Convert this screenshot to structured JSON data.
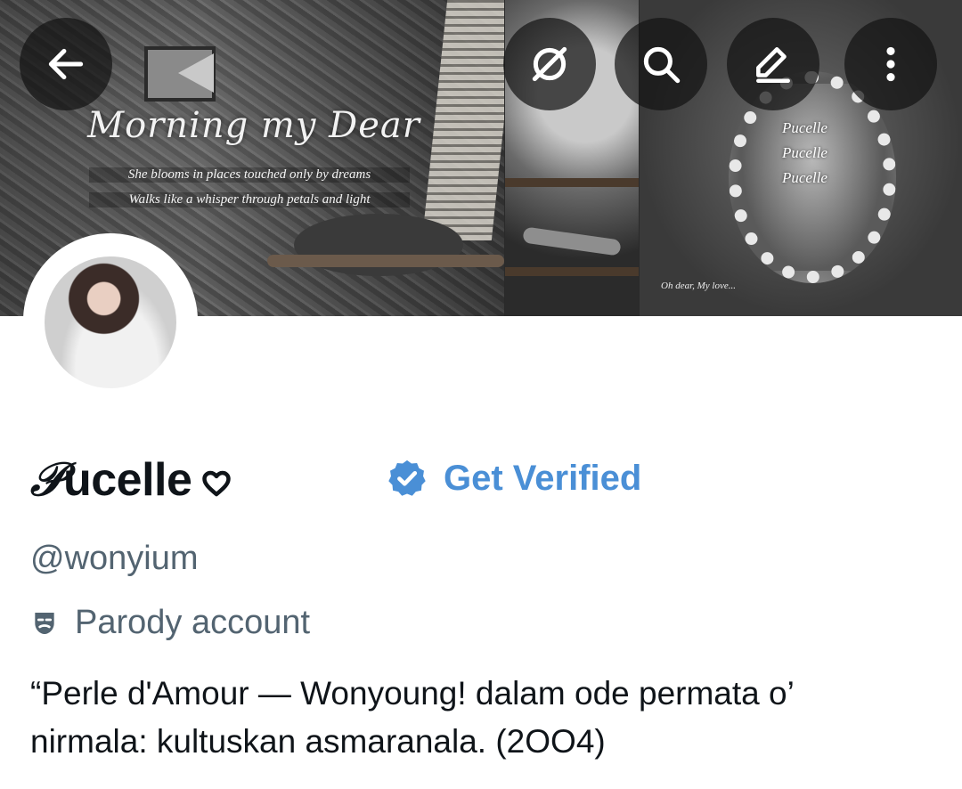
{
  "banner": {
    "title_script": "Morning my Dear",
    "line1": "She blooms in places touched only by dreams",
    "line2": "Walks like a whisper through petals and light",
    "pucelle_words": [
      "Pucelle",
      "Pucelle",
      "Pucelle"
    ],
    "caption": "Oh dear, My love..."
  },
  "toolbar": {
    "back": "back-arrow-icon",
    "grok": "grok-icon",
    "search": "search-icon",
    "edit": "edit-icon",
    "more": "more-vertical-icon"
  },
  "profile": {
    "name_initial": "𝒫",
    "name_rest": "ucelle",
    "heart": "heart-icon",
    "verified_label": "Get Verified",
    "handle": "@wonyium",
    "parody_label": "Parody account",
    "bio_line1": "“Perle d'Amour — Wonyoung! dalam ode permata o’",
    "bio_line2": "nirmala: kultuskan asmaranala.  (2OO4)"
  },
  "colors": {
    "accent": "#4a8fd6",
    "secondary_text": "#536471",
    "primary_text": "#0f1419"
  }
}
